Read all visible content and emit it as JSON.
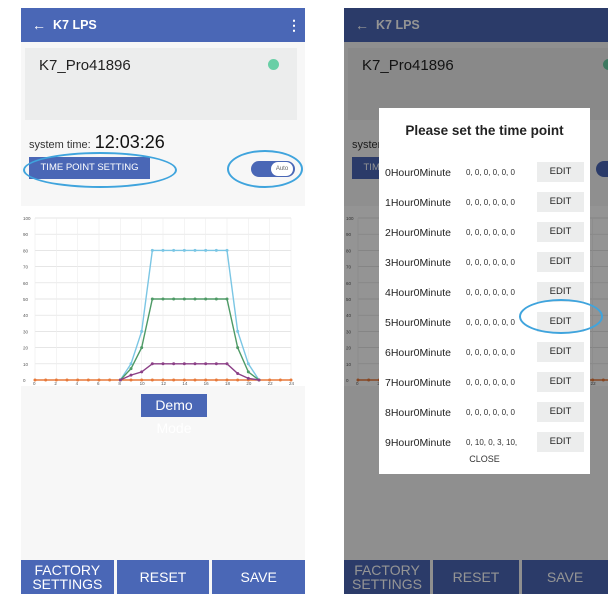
{
  "app": {
    "title": "K7 LPS",
    "back_icon": "←",
    "menu_icon": "⋮"
  },
  "device": {
    "name": "K7_Pro41896",
    "status_color": "#69cfa6"
  },
  "system_time": {
    "label": "system time:",
    "value": "12:03:26"
  },
  "time_point_button": "TIME POINT SETTING",
  "auto_toggle": {
    "label": "Auto",
    "on": true
  },
  "demo_button": "Demo Mode",
  "bottom": {
    "factory": "FACTORY SETTINGS",
    "reset": "RESET",
    "save": "SAVE"
  },
  "chart_data": {
    "type": "line",
    "x_ticks": [
      0,
      2,
      4,
      6,
      8,
      10,
      12,
      14,
      16,
      18,
      20,
      22,
      24
    ],
    "y_ticks": [
      0,
      10,
      20,
      30,
      40,
      50,
      60,
      70,
      80,
      90,
      100
    ],
    "xlim": [
      0,
      24
    ],
    "ylim": [
      0,
      100
    ],
    "grid": true,
    "series": [
      {
        "color": "#e7793a",
        "points": [
          [
            0,
            0
          ],
          [
            1,
            0
          ],
          [
            2,
            0
          ],
          [
            3,
            0
          ],
          [
            4,
            0
          ],
          [
            5,
            0
          ],
          [
            6,
            0
          ],
          [
            7,
            0
          ],
          [
            8,
            0
          ],
          [
            9,
            0
          ],
          [
            10,
            0
          ],
          [
            11,
            0
          ],
          [
            12,
            0
          ],
          [
            13,
            0
          ],
          [
            14,
            0
          ],
          [
            15,
            0
          ],
          [
            16,
            0
          ],
          [
            17,
            0
          ],
          [
            18,
            0
          ],
          [
            19,
            0
          ],
          [
            20,
            0
          ],
          [
            21,
            0
          ],
          [
            22,
            0
          ],
          [
            23,
            0
          ],
          [
            24,
            0
          ]
        ]
      },
      {
        "color": "#7bc6e4",
        "points": [
          [
            8,
            0
          ],
          [
            9,
            10
          ],
          [
            10,
            30
          ],
          [
            11,
            80
          ],
          [
            12,
            80
          ],
          [
            13,
            80
          ],
          [
            14,
            80
          ],
          [
            15,
            80
          ],
          [
            16,
            80
          ],
          [
            17,
            80
          ],
          [
            18,
            80
          ],
          [
            19,
            30
          ],
          [
            20,
            10
          ],
          [
            21,
            0
          ]
        ]
      },
      {
        "color": "#4e9a66",
        "points": [
          [
            8,
            0
          ],
          [
            9,
            7
          ],
          [
            10,
            20
          ],
          [
            11,
            50
          ],
          [
            12,
            50
          ],
          [
            13,
            50
          ],
          [
            14,
            50
          ],
          [
            15,
            50
          ],
          [
            16,
            50
          ],
          [
            17,
            50
          ],
          [
            18,
            50
          ],
          [
            19,
            20
          ],
          [
            20,
            5
          ],
          [
            21,
            0
          ]
        ]
      },
      {
        "color": "#8b3f86",
        "points": [
          [
            8,
            0
          ],
          [
            9,
            3
          ],
          [
            10,
            5
          ],
          [
            11,
            10
          ],
          [
            12,
            10
          ],
          [
            13,
            10
          ],
          [
            14,
            10
          ],
          [
            15,
            10
          ],
          [
            16,
            10
          ],
          [
            17,
            10
          ],
          [
            18,
            10
          ],
          [
            19,
            4
          ],
          [
            20,
            1
          ],
          [
            21,
            0
          ]
        ]
      }
    ]
  },
  "dialog": {
    "title": "Please set the time point",
    "rows": [
      {
        "label": "0Hour0Minute",
        "values": "0, 0, 0, 0, 0, 0",
        "button": "EDIT"
      },
      {
        "label": "1Hour0Minute",
        "values": "0, 0, 0, 0, 0, 0",
        "button": "EDIT"
      },
      {
        "label": "2Hour0Minute",
        "values": "0, 0, 0, 0, 0, 0",
        "button": "EDIT"
      },
      {
        "label": "3Hour0Minute",
        "values": "0, 0, 0, 0, 0, 0",
        "button": "EDIT"
      },
      {
        "label": "4Hour0Minute",
        "values": "0, 0, 0, 0, 0, 0",
        "button": "EDIT"
      },
      {
        "label": "5Hour0Minute",
        "values": "0, 0, 0, 0, 0, 0",
        "button": "EDIT"
      },
      {
        "label": "6Hour0Minute",
        "values": "0, 0, 0, 0, 0, 0",
        "button": "EDIT"
      },
      {
        "label": "7Hour0Minute",
        "values": "0, 0, 0, 0, 0, 0",
        "button": "EDIT"
      },
      {
        "label": "8Hour0Minute",
        "values": "0, 0, 0, 0, 0, 0",
        "button": "EDIT"
      },
      {
        "label": "9Hour0Minute",
        "values": "0, 10, 0, 3, 10,",
        "button": "EDIT"
      }
    ],
    "close": "CLOSE"
  },
  "highlight_color": "#3fa4dd"
}
